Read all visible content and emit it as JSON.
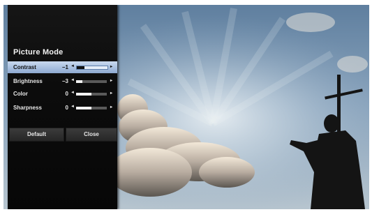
{
  "picture_mode": {
    "title": "Picture Mode",
    "settings": [
      {
        "label": "Contrast",
        "value": "−1",
        "level": 0.25,
        "selected": true
      },
      {
        "label": "Brightness",
        "value": "−3",
        "level": 0.2,
        "selected": false
      },
      {
        "label": "Color",
        "value": "0",
        "level": 0.5,
        "selected": false
      },
      {
        "label": "Sharpness",
        "value": "0",
        "level": 0.5,
        "selected": false
      }
    ],
    "arrow_left": "◄",
    "arrow_right": "▸",
    "buttons": {
      "default_label": "Default",
      "close_label": "Close"
    }
  },
  "colors": {
    "selected_row": "#a8bfdf",
    "panel_background": "#0c0c0c"
  },
  "background_image": "sky-with-clouds-and-statue-silhouette"
}
